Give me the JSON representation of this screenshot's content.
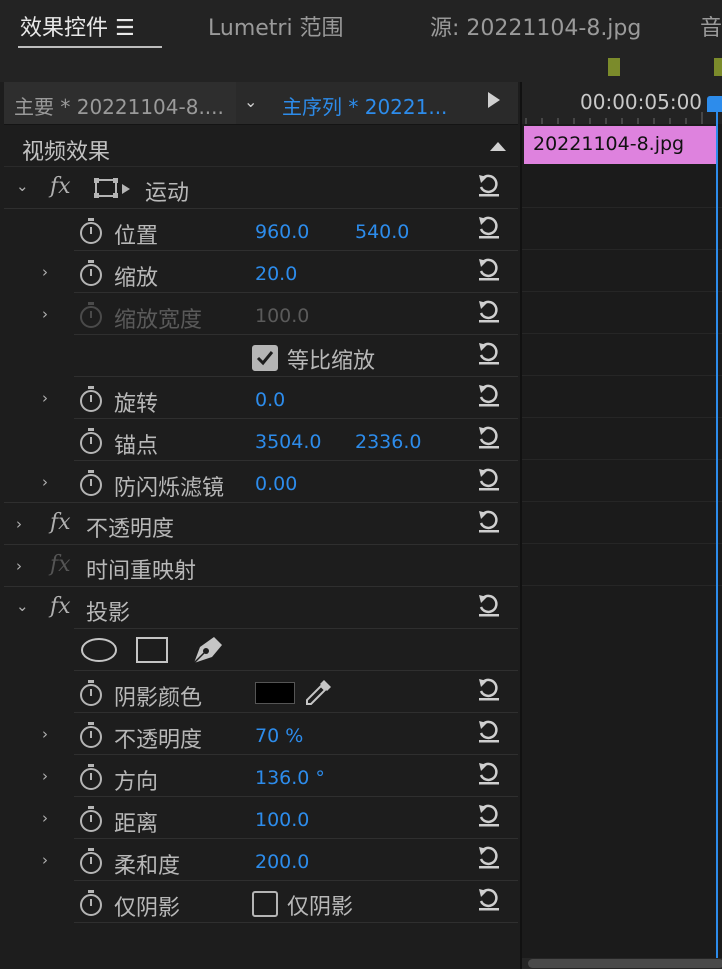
{
  "tabs": [
    {
      "label": "效果控件 ☰",
      "active": true
    },
    {
      "label": "Lumetri 范围"
    },
    {
      "label": "源: 20221104-8.jpg"
    },
    {
      "label": "音"
    }
  ],
  "sequence_bar": {
    "master_clip": "主要 * 20221104-8....",
    "sequence_name": "主序列 * 20221..."
  },
  "panel": {
    "section_title": "视频效果",
    "motion": {
      "name": "运动",
      "position": {
        "label": "位置",
        "x": "960.0",
        "y": "540.0"
      },
      "scale": {
        "label": "缩放",
        "value": "20.0"
      },
      "scale_width": {
        "label": "缩放宽度",
        "value": "100.0"
      },
      "uniform_scale": {
        "label": "等比缩放",
        "checked": true
      },
      "rotation": {
        "label": "旋转",
        "value": "0.0"
      },
      "anchor": {
        "label": "锚点",
        "x": "3504.0",
        "y": "2336.0"
      },
      "anti_flicker": {
        "label": "防闪烁滤镜",
        "value": "0.00"
      }
    },
    "opacity": {
      "name": "不透明度"
    },
    "time_remap": {
      "name": "时间重映射"
    },
    "drop_shadow": {
      "name": "投影",
      "shadow_color": {
        "label": "阴影颜色",
        "color": "#000000"
      },
      "opacity": {
        "label": "不透明度",
        "value": "70 %"
      },
      "direction": {
        "label": "方向",
        "value": "136.0 °"
      },
      "distance": {
        "label": "距离",
        "value": "100.0"
      },
      "softness": {
        "label": "柔和度",
        "value": "200.0"
      },
      "shadow_only": {
        "label": "仅阴影",
        "checkbox_label": "仅阴影",
        "checked": false
      }
    }
  },
  "timeline": {
    "timecode": "00:00:05:00",
    "clip_label": "20221104-8.jpg",
    "clip_color": "#de82de"
  },
  "colors": {
    "accent": "#2d8ceb",
    "background": "#1d1d1d"
  }
}
